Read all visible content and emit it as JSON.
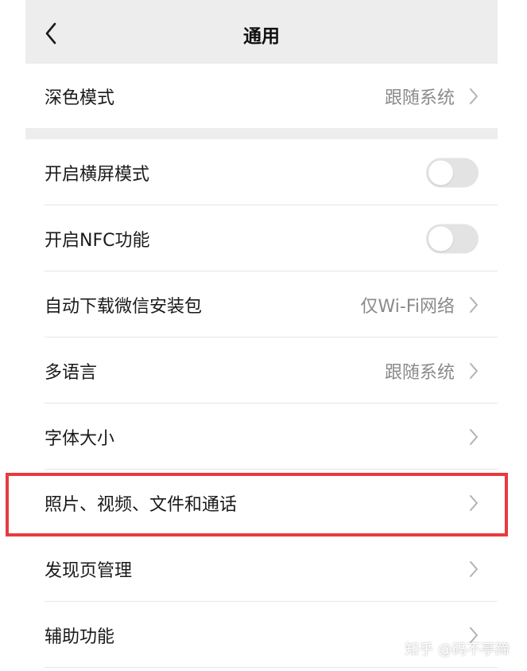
{
  "header": {
    "title": "通用"
  },
  "settings": {
    "dark_mode": {
      "label": "深色模式",
      "value": "跟随系统"
    },
    "landscape": {
      "label": "开启横屏模式",
      "enabled": false
    },
    "nfc": {
      "label": "开启NFC功能",
      "enabled": false
    },
    "auto_download": {
      "label": "自动下载微信安装包",
      "value": "仅Wi-Fi网络"
    },
    "language": {
      "label": "多语言",
      "value": "跟随系统"
    },
    "font_size": {
      "label": "字体大小"
    },
    "media": {
      "label": "照片、视频、文件和通话"
    },
    "discover": {
      "label": "发现页管理"
    },
    "accessibility": {
      "label": "辅助功能"
    }
  },
  "annotation": {
    "highlight_color": "#e73b3e"
  },
  "watermark": "知乎 @码不亭蹄",
  "colors": {
    "background": "#ededed",
    "card": "#ffffff",
    "text": "#1a1a1a",
    "secondary_text": "#8a8a8a",
    "toggle_off": "#e3e3e3"
  }
}
